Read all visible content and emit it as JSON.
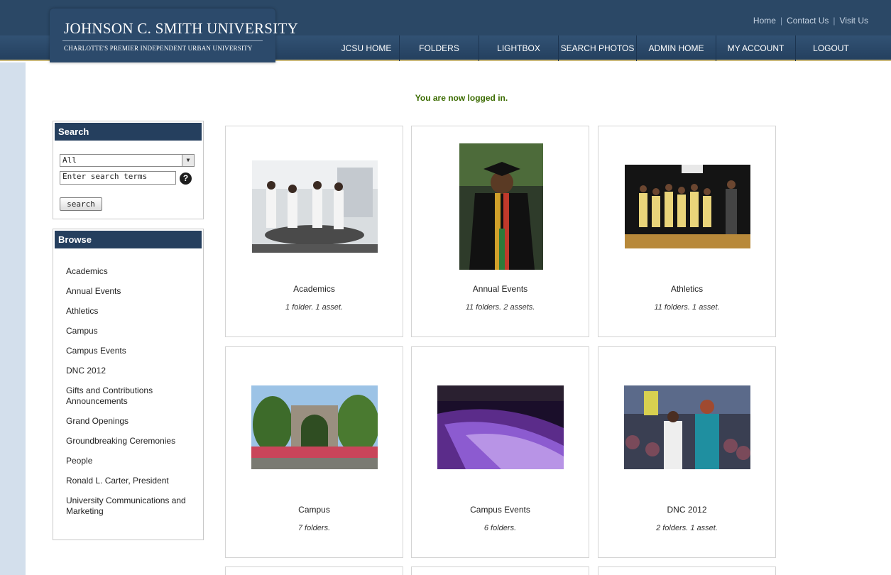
{
  "header": {
    "logo_title": "JOHNSON C. SMITH UNIVERSITY",
    "logo_subtitle": "CHARLOTTE'S PREMIER INDEPENDENT URBAN UNIVERSITY",
    "top_links": [
      "Home",
      "Contact Us",
      "Visit Us"
    ],
    "nav": [
      "JCSU HOME",
      "FOLDERS",
      "LIGHTBOX",
      "SEARCH PHOTOS",
      "ADMIN HOME",
      "MY ACCOUNT",
      "LOGOUT"
    ]
  },
  "notice": "You are now logged in.",
  "search_panel": {
    "title": "Search",
    "select_value": "All",
    "input_value": "Enter search terms",
    "button_label": "search"
  },
  "browse_panel": {
    "title": "Browse",
    "items": [
      "Academics",
      "Annual Events",
      "Athletics",
      "Campus",
      "Campus Events",
      "DNC 2012",
      "Gifts and Contributions Announcements",
      "Grand Openings",
      "Groundbreaking Ceremonies",
      "People",
      "Ronald L. Carter, President",
      "University Communications and Marketing"
    ]
  },
  "folders": [
    {
      "title": "Academics",
      "meta": "1 folder.  1 asset."
    },
    {
      "title": "Annual Events",
      "meta": "11 folders.  2 assets."
    },
    {
      "title": "Athletics",
      "meta": "11 folders.  1 asset."
    },
    {
      "title": "Campus",
      "meta": "7 folders."
    },
    {
      "title": "Campus Events",
      "meta": "6 folders."
    },
    {
      "title": "DNC 2012",
      "meta": "2 folders.  1 asset."
    }
  ],
  "colors": {
    "header": "#2b4866",
    "panel_head": "#253f5e",
    "notice": "#3b6b00"
  }
}
